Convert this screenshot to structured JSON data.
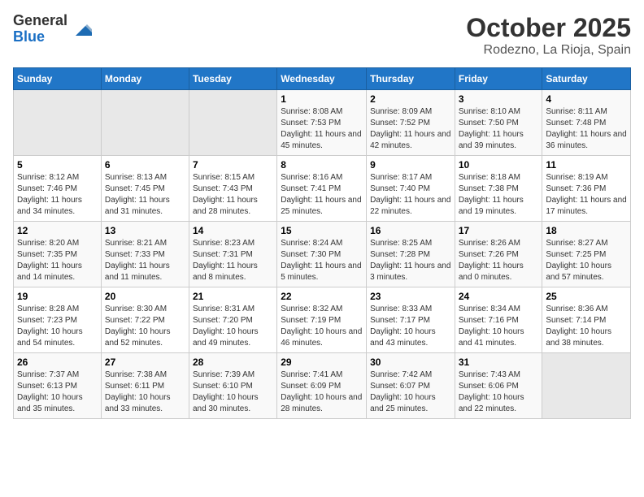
{
  "header": {
    "logo_line1": "General",
    "logo_line2": "Blue",
    "title": "October 2025",
    "subtitle": "Rodezno, La Rioja, Spain"
  },
  "days_of_week": [
    "Sunday",
    "Monday",
    "Tuesday",
    "Wednesday",
    "Thursday",
    "Friday",
    "Saturday"
  ],
  "weeks": [
    [
      {
        "day": "",
        "info": ""
      },
      {
        "day": "",
        "info": ""
      },
      {
        "day": "",
        "info": ""
      },
      {
        "day": "1",
        "info": "Sunrise: 8:08 AM\nSunset: 7:53 PM\nDaylight: 11 hours and 45 minutes."
      },
      {
        "day": "2",
        "info": "Sunrise: 8:09 AM\nSunset: 7:52 PM\nDaylight: 11 hours and 42 minutes."
      },
      {
        "day": "3",
        "info": "Sunrise: 8:10 AM\nSunset: 7:50 PM\nDaylight: 11 hours and 39 minutes."
      },
      {
        "day": "4",
        "info": "Sunrise: 8:11 AM\nSunset: 7:48 PM\nDaylight: 11 hours and 36 minutes."
      }
    ],
    [
      {
        "day": "5",
        "info": "Sunrise: 8:12 AM\nSunset: 7:46 PM\nDaylight: 11 hours and 34 minutes."
      },
      {
        "day": "6",
        "info": "Sunrise: 8:13 AM\nSunset: 7:45 PM\nDaylight: 11 hours and 31 minutes."
      },
      {
        "day": "7",
        "info": "Sunrise: 8:15 AM\nSunset: 7:43 PM\nDaylight: 11 hours and 28 minutes."
      },
      {
        "day": "8",
        "info": "Sunrise: 8:16 AM\nSunset: 7:41 PM\nDaylight: 11 hours and 25 minutes."
      },
      {
        "day": "9",
        "info": "Sunrise: 8:17 AM\nSunset: 7:40 PM\nDaylight: 11 hours and 22 minutes."
      },
      {
        "day": "10",
        "info": "Sunrise: 8:18 AM\nSunset: 7:38 PM\nDaylight: 11 hours and 19 minutes."
      },
      {
        "day": "11",
        "info": "Sunrise: 8:19 AM\nSunset: 7:36 PM\nDaylight: 11 hours and 17 minutes."
      }
    ],
    [
      {
        "day": "12",
        "info": "Sunrise: 8:20 AM\nSunset: 7:35 PM\nDaylight: 11 hours and 14 minutes."
      },
      {
        "day": "13",
        "info": "Sunrise: 8:21 AM\nSunset: 7:33 PM\nDaylight: 11 hours and 11 minutes."
      },
      {
        "day": "14",
        "info": "Sunrise: 8:23 AM\nSunset: 7:31 PM\nDaylight: 11 hours and 8 minutes."
      },
      {
        "day": "15",
        "info": "Sunrise: 8:24 AM\nSunset: 7:30 PM\nDaylight: 11 hours and 5 minutes."
      },
      {
        "day": "16",
        "info": "Sunrise: 8:25 AM\nSunset: 7:28 PM\nDaylight: 11 hours and 3 minutes."
      },
      {
        "day": "17",
        "info": "Sunrise: 8:26 AM\nSunset: 7:26 PM\nDaylight: 11 hours and 0 minutes."
      },
      {
        "day": "18",
        "info": "Sunrise: 8:27 AM\nSunset: 7:25 PM\nDaylight: 10 hours and 57 minutes."
      }
    ],
    [
      {
        "day": "19",
        "info": "Sunrise: 8:28 AM\nSunset: 7:23 PM\nDaylight: 10 hours and 54 minutes."
      },
      {
        "day": "20",
        "info": "Sunrise: 8:30 AM\nSunset: 7:22 PM\nDaylight: 10 hours and 52 minutes."
      },
      {
        "day": "21",
        "info": "Sunrise: 8:31 AM\nSunset: 7:20 PM\nDaylight: 10 hours and 49 minutes."
      },
      {
        "day": "22",
        "info": "Sunrise: 8:32 AM\nSunset: 7:19 PM\nDaylight: 10 hours and 46 minutes."
      },
      {
        "day": "23",
        "info": "Sunrise: 8:33 AM\nSunset: 7:17 PM\nDaylight: 10 hours and 43 minutes."
      },
      {
        "day": "24",
        "info": "Sunrise: 8:34 AM\nSunset: 7:16 PM\nDaylight: 10 hours and 41 minutes."
      },
      {
        "day": "25",
        "info": "Sunrise: 8:36 AM\nSunset: 7:14 PM\nDaylight: 10 hours and 38 minutes."
      }
    ],
    [
      {
        "day": "26",
        "info": "Sunrise: 7:37 AM\nSunset: 6:13 PM\nDaylight: 10 hours and 35 minutes."
      },
      {
        "day": "27",
        "info": "Sunrise: 7:38 AM\nSunset: 6:11 PM\nDaylight: 10 hours and 33 minutes."
      },
      {
        "day": "28",
        "info": "Sunrise: 7:39 AM\nSunset: 6:10 PM\nDaylight: 10 hours and 30 minutes."
      },
      {
        "day": "29",
        "info": "Sunrise: 7:41 AM\nSunset: 6:09 PM\nDaylight: 10 hours and 28 minutes."
      },
      {
        "day": "30",
        "info": "Sunrise: 7:42 AM\nSunset: 6:07 PM\nDaylight: 10 hours and 25 minutes."
      },
      {
        "day": "31",
        "info": "Sunrise: 7:43 AM\nSunset: 6:06 PM\nDaylight: 10 hours and 22 minutes."
      },
      {
        "day": "",
        "info": ""
      }
    ]
  ]
}
